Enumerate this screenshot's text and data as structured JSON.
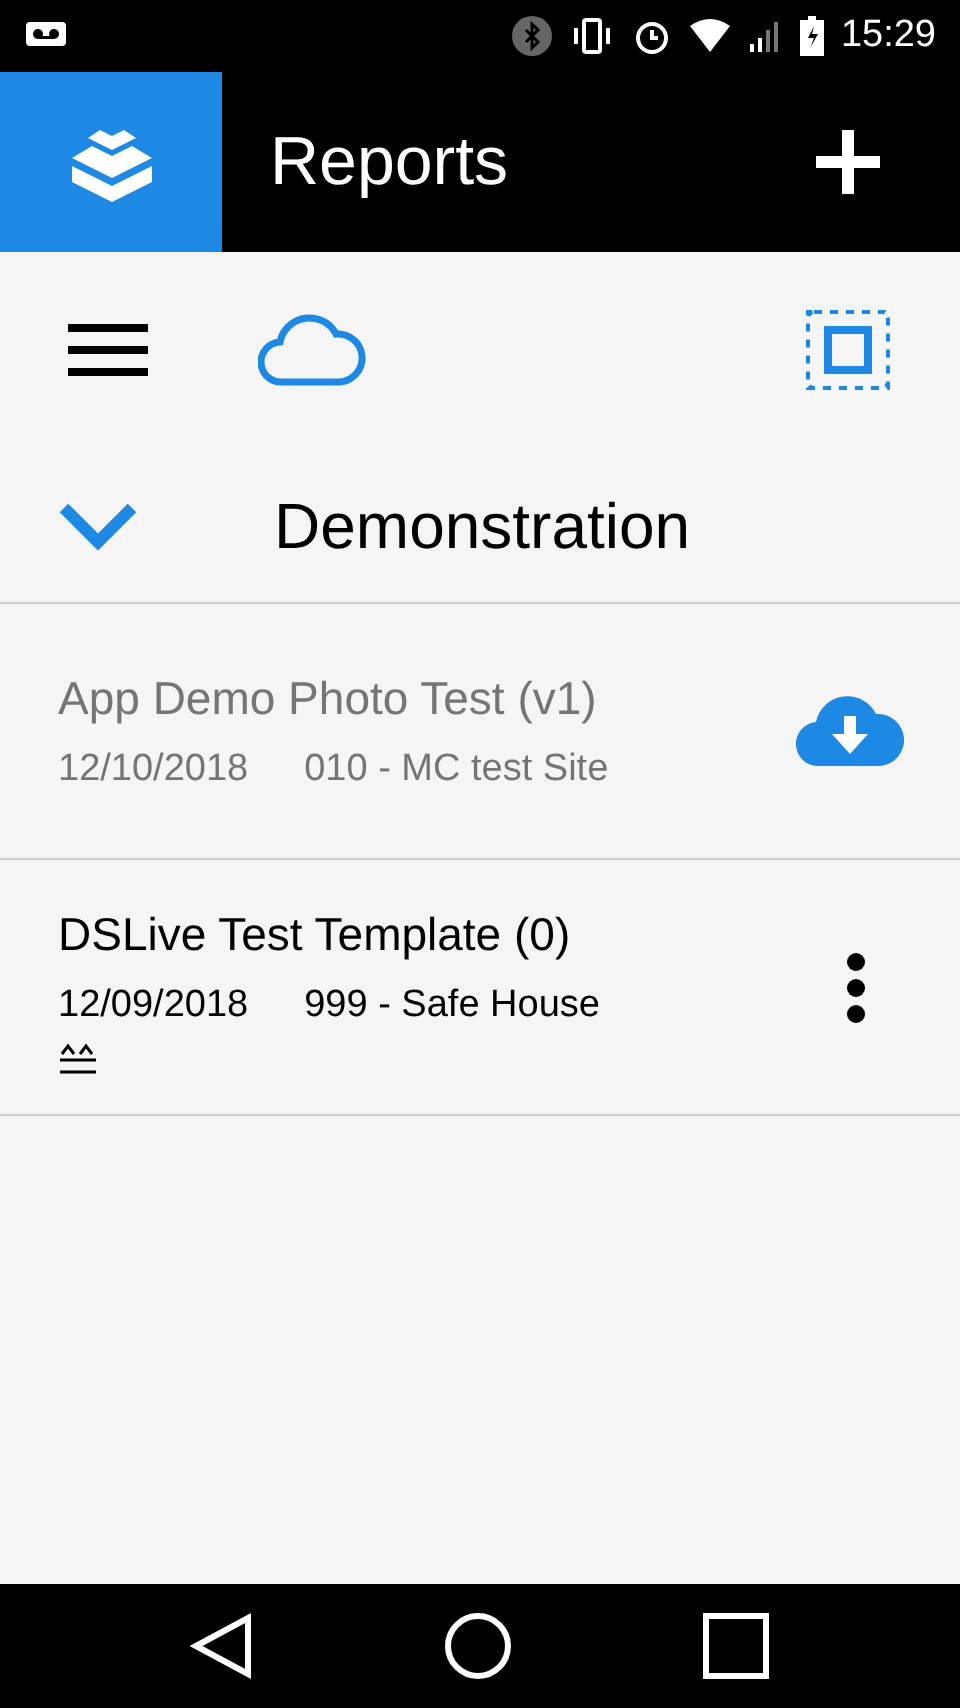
{
  "status_bar": {
    "time": "15:29"
  },
  "app_bar": {
    "title": "Reports"
  },
  "group": {
    "title": "Demonstration",
    "expanded": true
  },
  "reports": [
    {
      "kind": "remote",
      "title": "App Demo Photo Test (v1)",
      "date": "12/10/2018",
      "site": "010 - MC test Site"
    },
    {
      "kind": "local",
      "title": "DSLive Test Template (0)",
      "date": "12/09/2018",
      "site": "999 - Safe House"
    }
  ]
}
